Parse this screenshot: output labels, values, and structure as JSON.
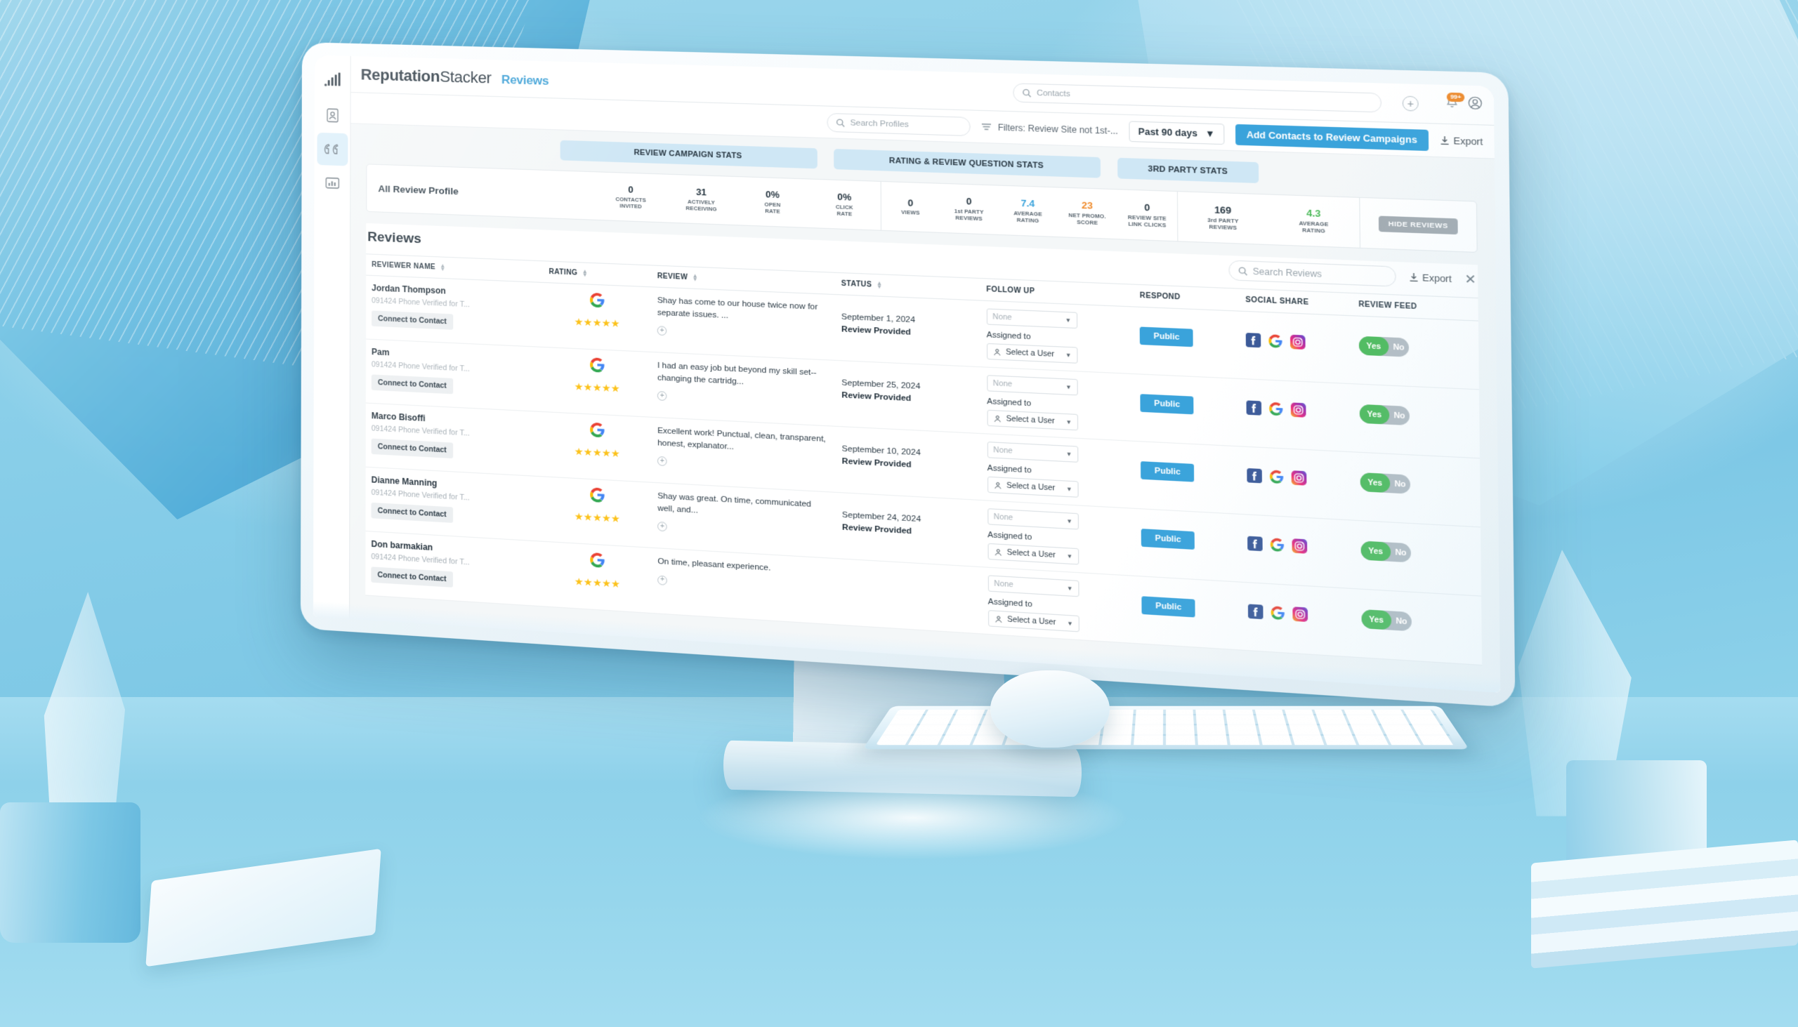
{
  "app": {
    "brand_bold": "Reputation",
    "brand_light": "Stacker",
    "section": "Reviews"
  },
  "rail": {
    "items": [
      {
        "name": "logo-bars-icon",
        "label": "Dashboard"
      },
      {
        "name": "contacts-icon",
        "label": "Contacts"
      },
      {
        "name": "quotes-reviews-icon",
        "label": "Reviews"
      },
      {
        "name": "reports-chart-icon",
        "label": "Reports"
      }
    ]
  },
  "header": {
    "contacts_search_placeholder": "Contacts",
    "add_icon": "plus-circle-icon",
    "notifications_badge": "99+",
    "avatar_icon": "user-circle-icon"
  },
  "toolbar": {
    "search_profiles_placeholder": "Search Profiles",
    "filters_label": "Filters: Review Site not 1st-...",
    "date_range": "Past 90 days",
    "primary_button": "Add Contacts to Review Campaigns",
    "export_label": "Export"
  },
  "stat_tabs": [
    {
      "label": "REVIEW CAMPAIGN STATS"
    },
    {
      "label": "RATING & REVIEW QUESTION STATS"
    },
    {
      "label": "3RD PARTY STATS"
    }
  ],
  "stats": {
    "profile_title": "All Review Profile",
    "hide_reviews_button": "HIDE REVIEWS",
    "campaign": [
      {
        "value": "0",
        "label": "CONTACTS\nINVITED",
        "color": "default"
      },
      {
        "value": "31",
        "label": "ACTIVELY\nRECEIVING",
        "color": "default"
      },
      {
        "value": "0%",
        "label": "OPEN\nRATE",
        "color": "default"
      },
      {
        "value": "0%",
        "label": "CLICK\nRATE",
        "color": "default"
      }
    ],
    "rating": [
      {
        "value": "0",
        "label": "VIEWS",
        "color": "default"
      },
      {
        "value": "0",
        "label": "1st PARTY\nREVIEWS",
        "color": "default"
      },
      {
        "value": "7.4",
        "label": "AVERAGE\nRATING",
        "color": "blue"
      },
      {
        "value": "23",
        "label": "NET PROMO.\nSCORE",
        "color": "orange"
      },
      {
        "value": "0",
        "label": "REVIEW SITE\nLINK CLICKS",
        "color": "default"
      }
    ],
    "third_party": [
      {
        "value": "169",
        "label": "3rd PARTY\nREVIEWS",
        "color": "default"
      },
      {
        "value": "4.3",
        "label": "AVERAGE\nRATING",
        "color": "green"
      }
    ]
  },
  "reviews_panel": {
    "title": "Reviews",
    "search_placeholder": "Search Reviews",
    "export_label": "Export",
    "close_icon": "close-icon",
    "columns": [
      {
        "label": "REVIEWER NAME",
        "sortable": true
      },
      {
        "label": "RATING",
        "sortable": true
      },
      {
        "label": "REVIEW",
        "sortable": true
      },
      {
        "label": "STATUS",
        "sortable": true
      },
      {
        "label": "FOLLOW UP",
        "sortable": false
      },
      {
        "label": "RESPOND",
        "sortable": false
      },
      {
        "label": "SOCIAL SHARE",
        "sortable": false
      },
      {
        "label": "REVIEW FEED",
        "sortable": false
      }
    ],
    "common": {
      "connect_button": "Connect to Contact",
      "followup_none": "None",
      "assigned_to_label": "Assigned to",
      "select_user": "Select a User",
      "respond_button": "Public",
      "feed_yes": "Yes",
      "feed_no": "No",
      "source_icon": "google-icon",
      "social_icons": [
        "facebook-icon",
        "google-icon",
        "instagram-icon"
      ]
    },
    "rows": [
      {
        "name": "Jordan Thompson",
        "sub": "091424 Phone Verified for T...",
        "stars": 5,
        "text": "Shay has come to our house twice now for separate issues. ...",
        "date": "September 1, 2024",
        "status": "Review Provided",
        "feed": "yes"
      },
      {
        "name": "Pam",
        "sub": "091424 Phone Verified for T...",
        "stars": 5,
        "text": "I had an easy job but beyond my skill set--changing the cartridg...",
        "date": "September 25, 2024",
        "status": "Review Provided",
        "feed": "yes"
      },
      {
        "name": "Marco Bisoffi",
        "sub": "091424 Phone Verified for T...",
        "stars": 5,
        "text": "Excellent work! Punctual, clean, transparent, honest, explanator...",
        "date": "September 10, 2024",
        "status": "Review Provided",
        "feed": "yes"
      },
      {
        "name": "Dianne Manning",
        "sub": "091424 Phone Verified for T...",
        "stars": 5,
        "text": "Shay was great. On time, communicated well, and...",
        "date": "September 24, 2024",
        "status": "Review Provided",
        "feed": "yes"
      },
      {
        "name": "Don barmakian",
        "sub": "091424 Phone Verified for T...",
        "stars": 5,
        "text": "On time, pleasant experience.",
        "date": "",
        "status": "",
        "feed": "yes"
      }
    ]
  },
  "colors": {
    "accent": "#3aa3db",
    "brand_section": "#3a9fd6",
    "tab_bg": "#cfe7f5",
    "star": "#fcc21b",
    "green": "#4cba5a",
    "orange": "#ef8b2c"
  }
}
